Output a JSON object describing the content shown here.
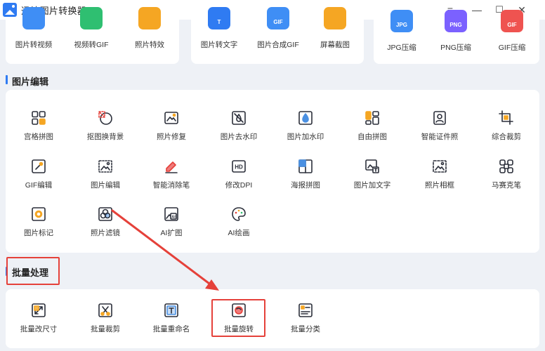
{
  "app": {
    "title": "迅捷图片转换器"
  },
  "window_controls": {
    "menu": "≡",
    "minimize": "—",
    "maximize": "☐",
    "close": "✕"
  },
  "top_tools": [
    {
      "label": "图片转视频",
      "color": "#3f8ef5"
    },
    {
      "label": "视频转GIF",
      "color": "#2fbf71"
    },
    {
      "label": "照片特效",
      "color": "#f5a623"
    },
    {
      "label": "图片转文字",
      "color": "#2f7bf2",
      "badge": "T"
    },
    {
      "label": "图片合成GIF",
      "color": "#3f8ef5",
      "badge": "GIF"
    },
    {
      "label": "屏幕截图",
      "color": "#f5a623"
    },
    {
      "label": "JPG压缩",
      "color": "#3f8ef5",
      "badge": "JPG"
    },
    {
      "label": "PNG压缩",
      "color": "#7b61ff",
      "badge": "PNG"
    },
    {
      "label": "GIF压缩",
      "color": "#ef5350",
      "badge": "GIF"
    }
  ],
  "sections": {
    "edit": {
      "title": "图片编辑"
    },
    "batch": {
      "title": "批量处理"
    }
  },
  "edit_tools": [
    {
      "label": "宫格拼图",
      "icon": "grid-icon"
    },
    {
      "label": "抠图换背景",
      "icon": "cutout-icon"
    },
    {
      "label": "照片修复",
      "icon": "photo-repair-icon"
    },
    {
      "label": "图片去水印",
      "icon": "remove-watermark-icon"
    },
    {
      "label": "图片加水印",
      "icon": "add-watermark-icon"
    },
    {
      "label": "自由拼图",
      "icon": "free-collage-icon"
    },
    {
      "label": "智能证件照",
      "icon": "id-photo-icon"
    },
    {
      "label": "综合裁剪",
      "icon": "crop-icon"
    },
    {
      "label": "GIF编辑",
      "icon": "gif-edit-icon"
    },
    {
      "label": "图片编辑",
      "icon": "image-edit-icon"
    },
    {
      "label": "智能消除笔",
      "icon": "eraser-icon"
    },
    {
      "label": "修改DPI",
      "icon": "hd-icon",
      "badge": "HD"
    },
    {
      "label": "海报拼图",
      "icon": "poster-icon"
    },
    {
      "label": "图片加文字",
      "icon": "add-text-icon"
    },
    {
      "label": "照片相框",
      "icon": "photo-frame-icon"
    },
    {
      "label": "马赛克笔",
      "icon": "mosaic-icon"
    },
    {
      "label": "图片标记",
      "icon": "mark-icon"
    },
    {
      "label": "照片滤镜",
      "icon": "filter-icon"
    },
    {
      "label": "AI扩图",
      "icon": "ai-expand-icon",
      "badge": "AI"
    },
    {
      "label": "AI绘画",
      "icon": "palette-icon"
    }
  ],
  "batch_tools": [
    {
      "label": "批量改尺寸",
      "icon": "resize-icon"
    },
    {
      "label": "批量裁剪",
      "icon": "batch-crop-icon"
    },
    {
      "label": "批量重命名",
      "icon": "rename-icon",
      "badge": "T"
    },
    {
      "label": "批量旋转",
      "icon": "rotate-icon"
    },
    {
      "label": "批量分类",
      "icon": "classify-icon"
    }
  ],
  "colors": {
    "accent": "#2f7bf2",
    "highlight": "#e5413a",
    "icon_stroke": "#2b2f3a",
    "icon_accent": "#f5a623"
  }
}
